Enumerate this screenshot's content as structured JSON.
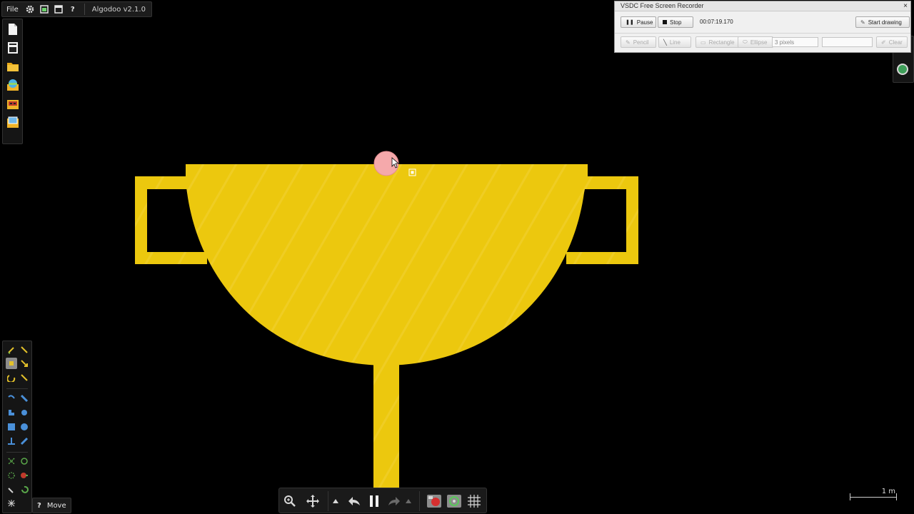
{
  "app": {
    "menu_file": "File",
    "title": "Algodoo v2.1.0"
  },
  "tools": {
    "help_label": "?",
    "current_tool": "Move"
  },
  "scale_bar": {
    "label": "1 m"
  },
  "recorder": {
    "title": "VSDC Free Screen Recorder",
    "pause": "Pause",
    "stop": "Stop",
    "elapsed": "00:07:19.170",
    "start_drawing": "Start drawing",
    "pencil": "Pencil",
    "line": "Line",
    "rectangle": "Rectangle",
    "ellipse": "Ellipse",
    "thickness": "3 pixels",
    "clear": "Clear",
    "close": "×"
  },
  "colors": {
    "trophy": "#ecc80e",
    "ball": "#f5a9ab",
    "canvas": "#000000"
  },
  "icons": [
    "settings-icon",
    "scene-icon",
    "window-icon",
    "help-icon",
    "new-scene-icon",
    "toolbar-icon",
    "open-folder-icon",
    "phunlet-icon",
    "sample-icon",
    "scene-folder-icon",
    "zoom-icon",
    "pan-icon",
    "undo-icon",
    "pause-icon",
    "redo-icon",
    "record-icon",
    "grid-icon"
  ]
}
